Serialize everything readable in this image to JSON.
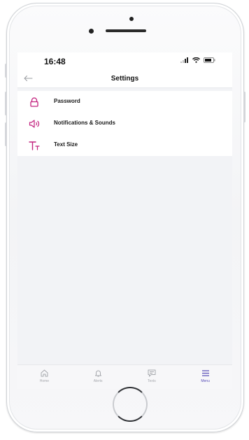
{
  "status_bar": {
    "time": "16:48"
  },
  "header": {
    "title": "Settings",
    "back_icon": "arrow-left-icon"
  },
  "menu": {
    "items": [
      {
        "label": "Password",
        "icon": "lock-icon"
      },
      {
        "label": "Notifications & Sounds",
        "icon": "speaker-icon"
      },
      {
        "label": "Text Size",
        "icon": "text-size-icon"
      }
    ]
  },
  "tabbar": {
    "tabs": [
      {
        "label": "Home",
        "icon": "home-icon",
        "active": false
      },
      {
        "label": "Alerts",
        "icon": "bell-icon",
        "active": false
      },
      {
        "label": "Texts",
        "icon": "message-icon",
        "active": false
      },
      {
        "label": "Menu",
        "icon": "menu-icon",
        "active": true
      }
    ]
  },
  "colors": {
    "accent_pink": "#c2227e",
    "accent_purple": "#5a4fb8",
    "screen_background": "#f2f3f6",
    "inactive_tab": "#a6a8ad"
  }
}
